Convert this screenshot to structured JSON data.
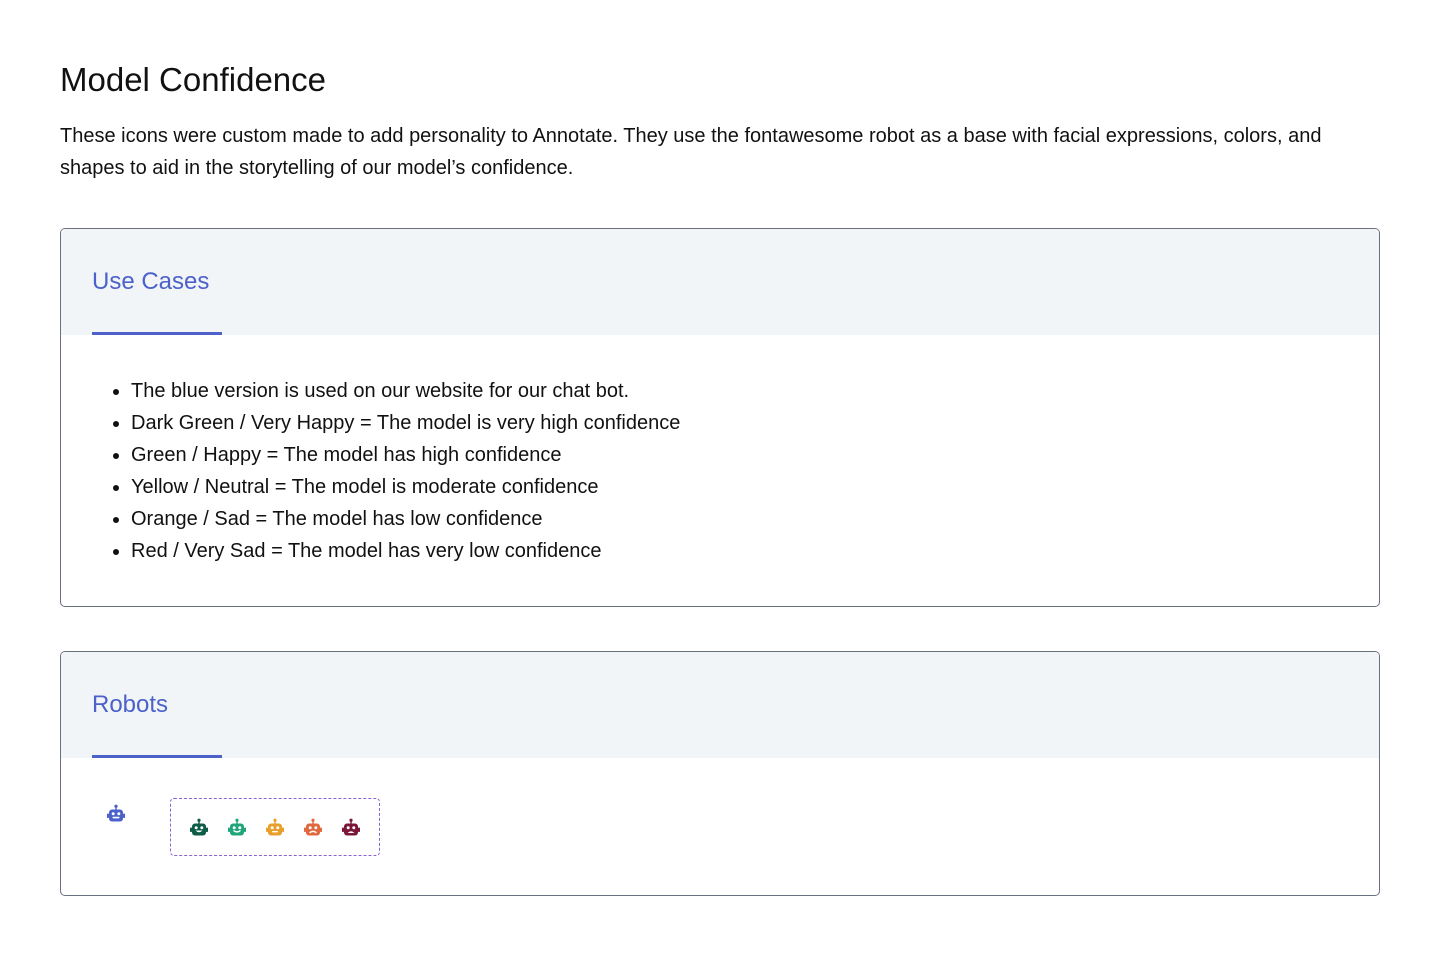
{
  "page": {
    "title": "Model Confidence",
    "intro": "These icons were custom made to add personality to Annotate. They use the fontawesome robot as a base with facial expressions, colors, and shapes to aid in the storytelling of our model’s confidence."
  },
  "use_cases": {
    "heading": "Use Cases",
    "items": [
      "The blue version is used on our website for our chat bot.",
      "Dark Green / Very Happy = The model is very high confidence",
      "Green / Happy = The model has high confidence",
      "Yellow / Neutral = The model is moderate confidence",
      "Orange / Sad = The model has low confidence",
      "Red / Very Sad = The model has very low confidence"
    ]
  },
  "robots": {
    "heading": "Robots",
    "chat_bot": {
      "icon": "robot-icon",
      "color": "#4c61c9"
    },
    "confidence_robots": [
      {
        "icon": "robot-very-happy-icon",
        "color": "#0d5c46"
      },
      {
        "icon": "robot-happy-icon",
        "color": "#22a57a"
      },
      {
        "icon": "robot-neutral-icon",
        "color": "#e89f2c"
      },
      {
        "icon": "robot-sad-icon",
        "color": "#e0683f"
      },
      {
        "icon": "robot-very-sad-icon",
        "color": "#7c1638"
      }
    ]
  },
  "colors": {
    "accent": "#4c61c9",
    "header_bg": "#f2f5f8",
    "dashed_border": "#8a63d2"
  }
}
